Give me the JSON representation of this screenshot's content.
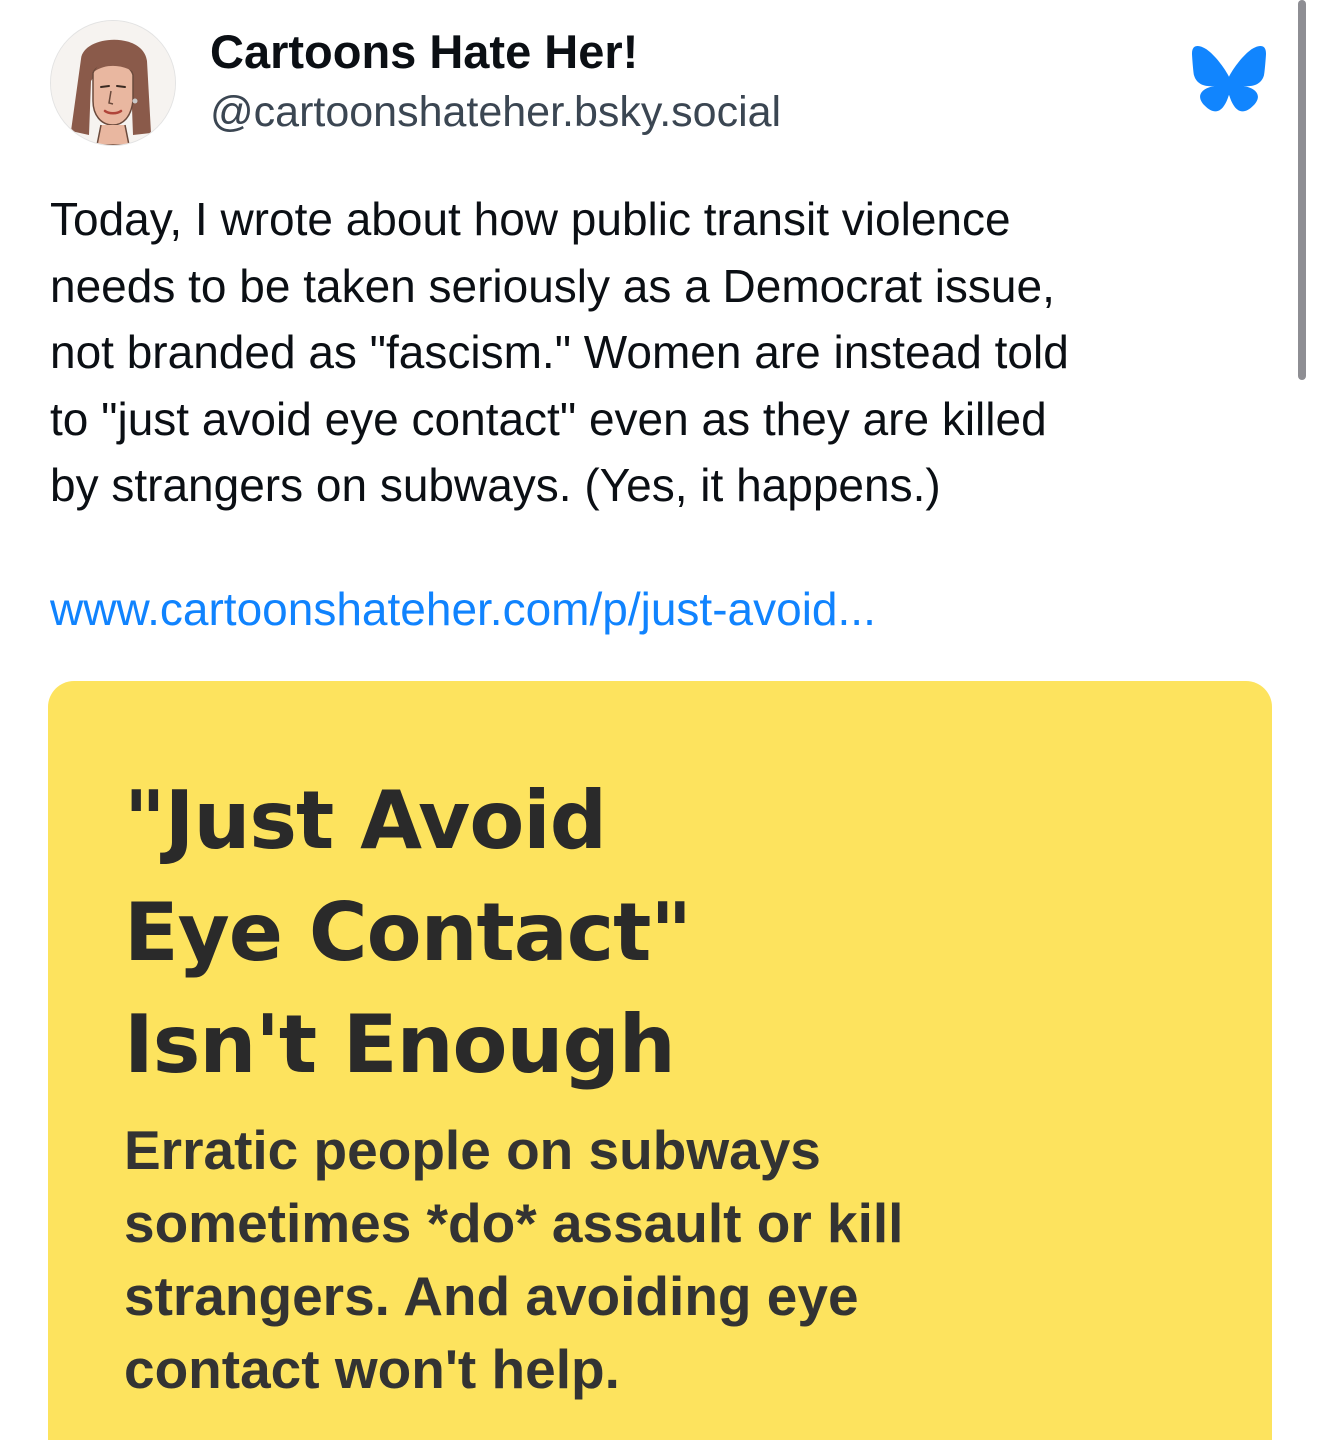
{
  "author": {
    "display_name": "Cartoons Hate Her!",
    "handle": "@cartoonshateher.bsky.social",
    "avatar_icon": "avatar-illustration-icon"
  },
  "brand": {
    "icon": "bluesky-butterfly-icon",
    "color": "#1185fe"
  },
  "post": {
    "text": "Today, I wrote about how public transit violence\nneeds to be taken seriously as a Democrat issue,\nnot branded as \"fascism.\" Women are instead told\nto \"just avoid eye contact\" even as they are killed\nby strangers on subways. (Yes, it happens.)",
    "link_text": "www.cartoonshateher.com/p/just-avoid...",
    "link_color": "#1083fe"
  },
  "link_card": {
    "background": "#fde35e",
    "title": "\"Just Avoid\nEye Contact\"\nIsn't Enough",
    "subtitle": "Erratic people on subways\nsometimes *do* assault or kill\nstrangers. And avoiding eye\ncontact won't help."
  }
}
